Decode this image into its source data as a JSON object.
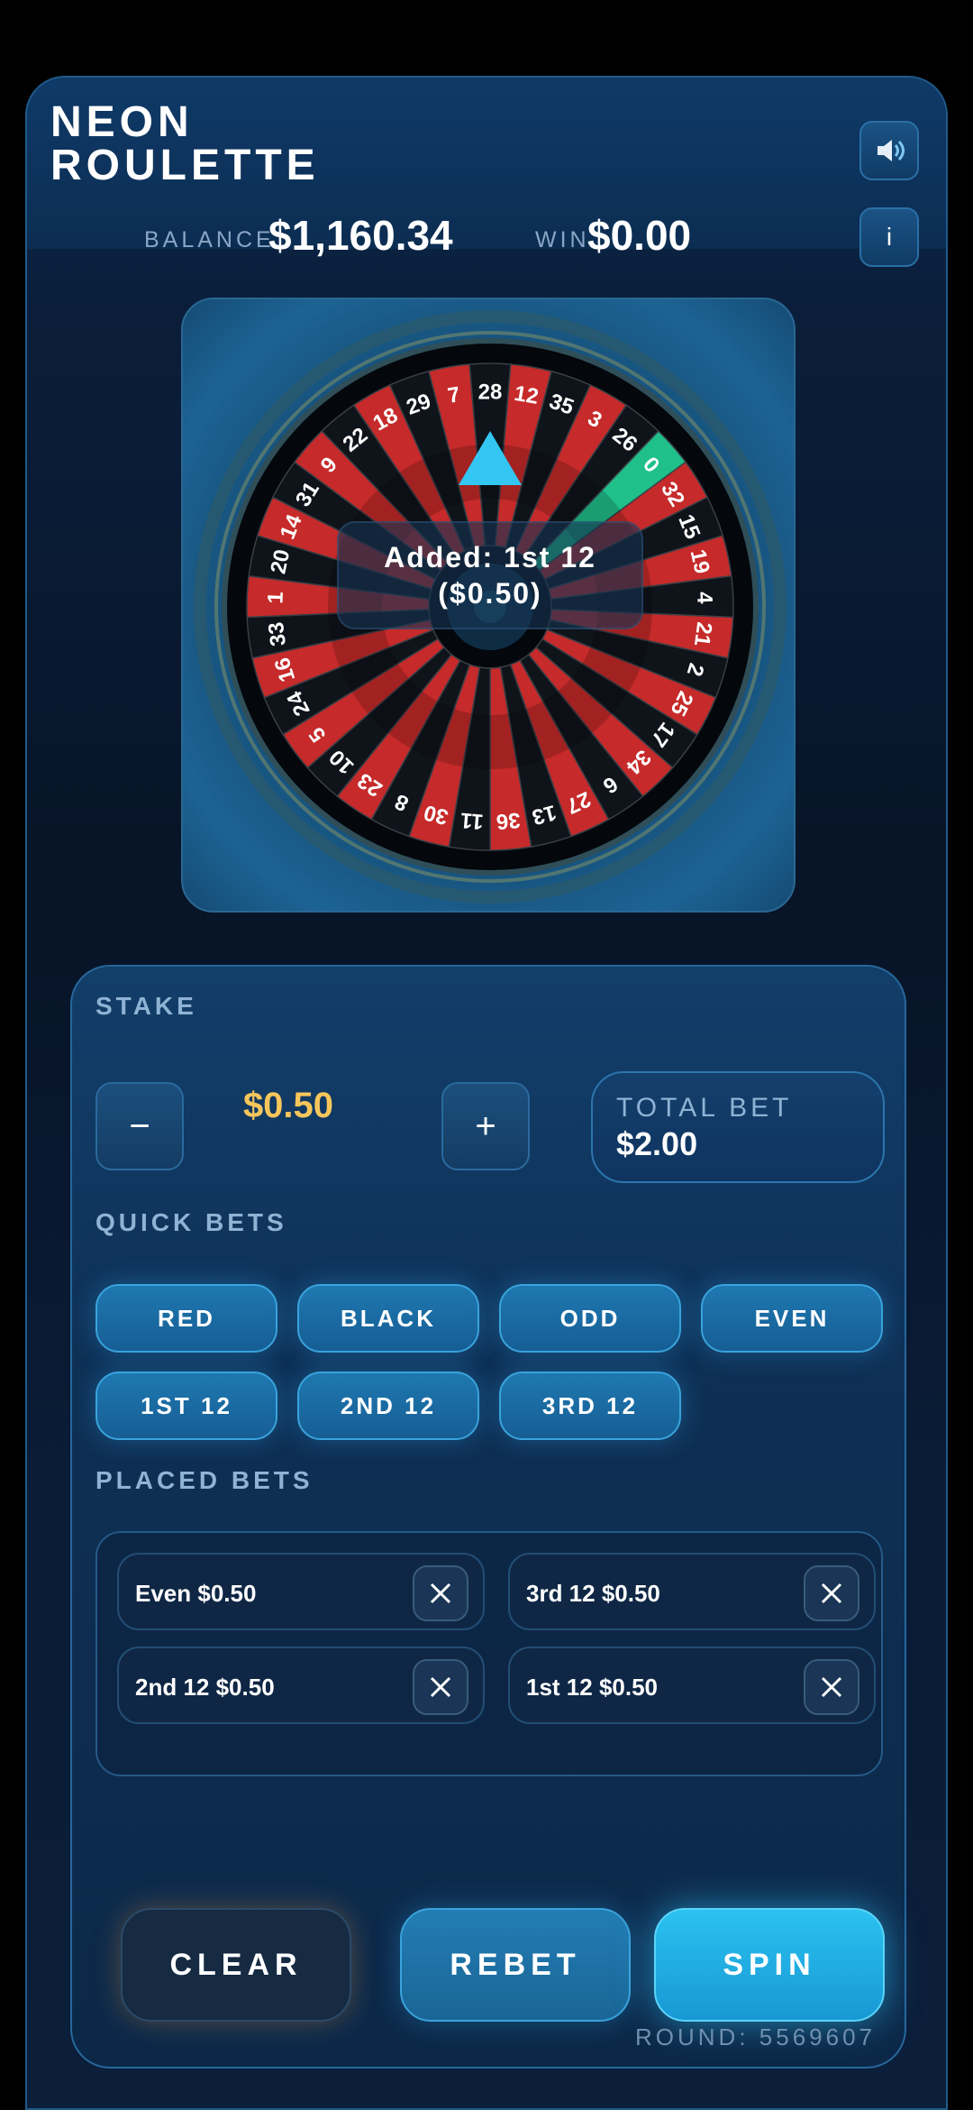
{
  "header": {
    "title_line1": "NEON",
    "title_line2": "ROULETTE",
    "balance_label": "BALANCE",
    "balance_value": "$1,160.34",
    "win_label": "WIN",
    "win_value": "$0.00",
    "sound_icon": "speaker-icon",
    "info_label": "i"
  },
  "wheel": {
    "numbers": [
      28,
      12,
      35,
      3,
      26,
      0,
      32,
      15,
      19,
      4,
      21,
      2,
      25,
      17,
      34,
      6,
      27,
      13,
      36,
      11,
      30,
      8,
      23,
      10,
      5,
      24,
      16,
      33,
      1,
      20,
      14,
      31,
      9,
      22,
      18,
      29,
      7
    ],
    "colors": {
      "red": "#c62a2a",
      "black": "#0f131a",
      "green": "#1fc08a",
      "pointer": "#34c6f2"
    },
    "toast_line1": "Added: 1st 12",
    "toast_line2": "($0.50)"
  },
  "stake": {
    "label": "STAKE",
    "minus": "−",
    "plus": "+",
    "value": "$0.50",
    "total_label": "TOTAL BET",
    "total_value": "$2.00"
  },
  "quick_bets": {
    "label": "QUICK BETS",
    "items": [
      "RED",
      "BLACK",
      "ODD",
      "EVEN",
      "1ST 12",
      "2ND 12",
      "3RD 12"
    ]
  },
  "placed_bets": {
    "label": "PLACED BETS",
    "items": [
      "Even  $0.50",
      "3rd 12  $0.50",
      "2nd 12  $0.50",
      "1st 12  $0.50"
    ]
  },
  "actions": {
    "clear": "CLEAR",
    "rebet": "REBET",
    "spin": "SPIN"
  },
  "round": "ROUND: 5569607"
}
